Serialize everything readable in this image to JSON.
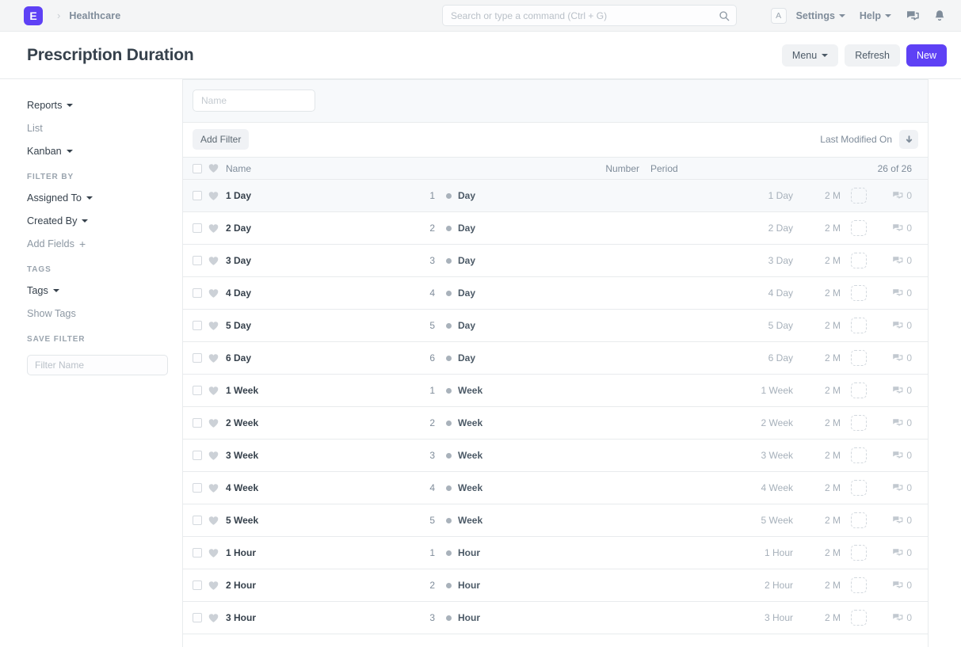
{
  "navbar": {
    "logo_letter": "E",
    "breadcrumb_separator": "›",
    "workspace": "Healthcare",
    "search_placeholder": "Search or type a command (Ctrl + G)",
    "search_value": "",
    "search_icon": "search-icon",
    "avatar_initial": "A",
    "settings_label": "Settings",
    "help_label": "Help",
    "chat_icon": "comments-icon",
    "bell_icon": "notification-bell-icon",
    "brand_color": "#5e41f5"
  },
  "page": {
    "title": "Prescription Duration",
    "menu_label": "Menu",
    "refresh_label": "Refresh",
    "new_label": "New"
  },
  "sidebar": {
    "reports_label": "Reports",
    "list_label": "List",
    "kanban_label": "Kanban",
    "filter_by_heading": "FILTER BY",
    "assigned_to_label": "Assigned To",
    "created_by_label": "Created By",
    "add_fields_label": "Add Fields",
    "add_fields_icon": "plus-icon",
    "tags_heading": "TAGS",
    "tags_label": "Tags",
    "show_tags_label": "Show Tags",
    "save_filter_heading": "SAVE FILTER",
    "filter_name_placeholder": "Filter Name",
    "filter_name_value": ""
  },
  "list_view": {
    "name_filter_placeholder": "Name",
    "name_filter_value": "",
    "add_filter_label": "Add Filter",
    "sort_label": "Last Modified On",
    "sort_direction_icon": "arrow-down-icon",
    "columns": {
      "name": "Name",
      "number": "Number",
      "period": "Period",
      "count": "26 of 26"
    },
    "rows": [
      {
        "name": "1 Day",
        "number": "1",
        "period": "Day",
        "title": "1 Day",
        "modified": "2 M",
        "comments": "0"
      },
      {
        "name": "2 Day",
        "number": "2",
        "period": "Day",
        "title": "2 Day",
        "modified": "2 M",
        "comments": "0"
      },
      {
        "name": "3 Day",
        "number": "3",
        "period": "Day",
        "title": "3 Day",
        "modified": "2 M",
        "comments": "0"
      },
      {
        "name": "4 Day",
        "number": "4",
        "period": "Day",
        "title": "4 Day",
        "modified": "2 M",
        "comments": "0"
      },
      {
        "name": "5 Day",
        "number": "5",
        "period": "Day",
        "title": "5 Day",
        "modified": "2 M",
        "comments": "0"
      },
      {
        "name": "6 Day",
        "number": "6",
        "period": "Day",
        "title": "6 Day",
        "modified": "2 M",
        "comments": "0"
      },
      {
        "name": "1 Week",
        "number": "1",
        "period": "Week",
        "title": "1 Week",
        "modified": "2 M",
        "comments": "0"
      },
      {
        "name": "2 Week",
        "number": "2",
        "period": "Week",
        "title": "2 Week",
        "modified": "2 M",
        "comments": "0"
      },
      {
        "name": "3 Week",
        "number": "3",
        "period": "Week",
        "title": "3 Week",
        "modified": "2 M",
        "comments": "0"
      },
      {
        "name": "4 Week",
        "number": "4",
        "period": "Week",
        "title": "4 Week",
        "modified": "2 M",
        "comments": "0"
      },
      {
        "name": "5 Week",
        "number": "5",
        "period": "Week",
        "title": "5 Week",
        "modified": "2 M",
        "comments": "0"
      },
      {
        "name": "1 Hour",
        "number": "1",
        "period": "Hour",
        "title": "1 Hour",
        "modified": "2 M",
        "comments": "0"
      },
      {
        "name": "2 Hour",
        "number": "2",
        "period": "Hour",
        "title": "2 Hour",
        "modified": "2 M",
        "comments": "0"
      },
      {
        "name": "3 Hour",
        "number": "3",
        "period": "Hour",
        "title": "3 Hour",
        "modified": "2 M",
        "comments": "0"
      }
    ]
  }
}
